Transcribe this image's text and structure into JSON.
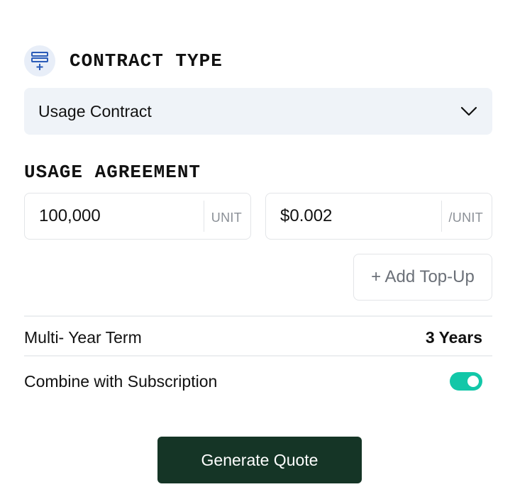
{
  "contract": {
    "title": "CONTRACT TYPE",
    "icon": "contract-list-icon",
    "selected": "Usage Contract"
  },
  "usage": {
    "title": "USAGE AGREEMENT",
    "quantity": "100,000",
    "quantity_unit": "UNIT",
    "price": "$0.002",
    "price_unit": "/UNIT",
    "add_topup_label": "+ Add Top-Up"
  },
  "term": {
    "label": "Multi- Year Term",
    "value": "3 Years"
  },
  "subscription": {
    "label": "Combine with Subscription",
    "enabled": true
  },
  "actions": {
    "generate_label": "Generate Quote"
  },
  "colors": {
    "accent_toggle": "#12c7a8",
    "primary_button": "#153526",
    "select_bg": "#eff3f8",
    "icon_bg": "#e8eef8",
    "icon_fg": "#2a5bb8"
  }
}
